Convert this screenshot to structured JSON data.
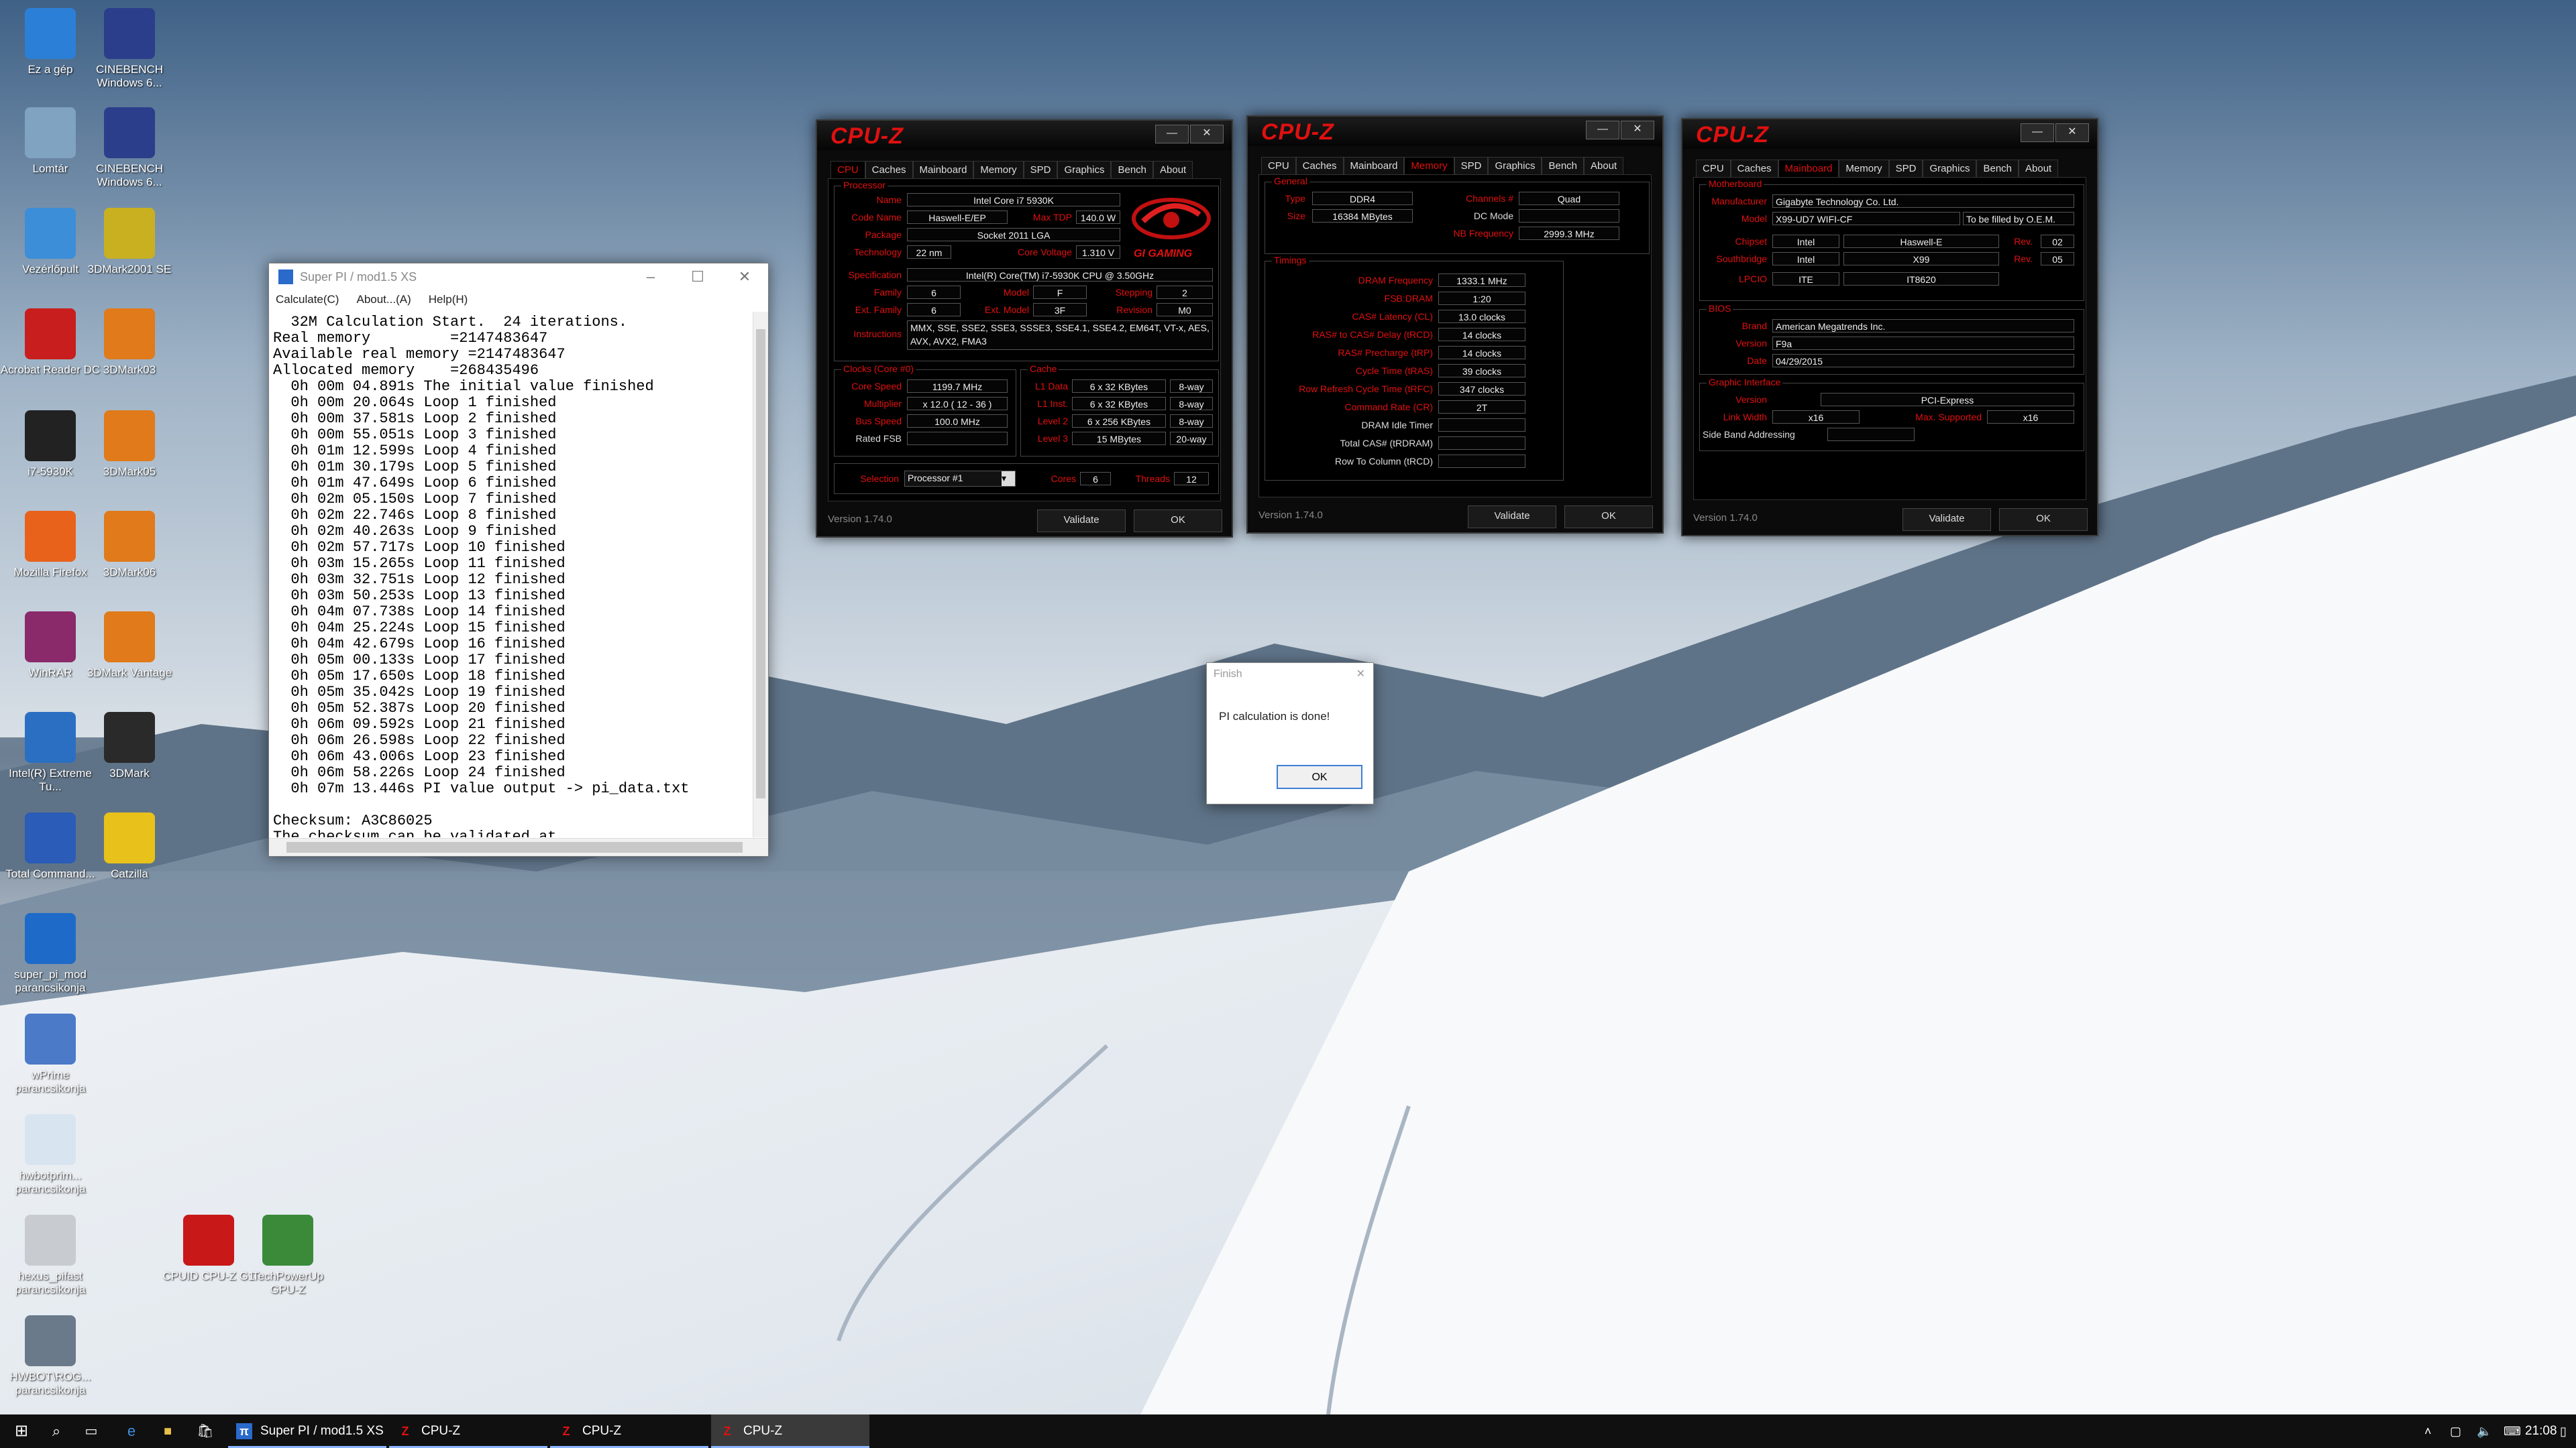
{
  "desktop_icons": [
    {
      "label": "Ez a gép",
      "icon": "computer-icon",
      "color": "#2c7fd6"
    },
    {
      "label": "CINEBENCH Windows 6...",
      "icon": "cinebench-icon",
      "color": "#2a3e8c"
    },
    {
      "label": "Lomtár",
      "icon": "recycle-bin-icon",
      "color": "#7fa3c0"
    },
    {
      "label": "CINEBENCH Windows 6...",
      "icon": "cinebench-icon",
      "color": "#2a3e8c"
    },
    {
      "label": "Vezérlőpult",
      "icon": "control-panel-icon",
      "color": "#3c8ed8"
    },
    {
      "label": "3DMark2001 SE",
      "icon": "3dmark2001-icon",
      "color": "#c9b020"
    },
    {
      "label": "Acrobat Reader DC",
      "icon": "acrobat-icon",
      "color": "#c81e1e"
    },
    {
      "label": "3DMark03",
      "icon": "3dmark03-icon",
      "color": "#e07a1a"
    },
    {
      "label": "i7-5930K",
      "icon": "file-icon",
      "color": "#222222"
    },
    {
      "label": "3DMark05",
      "icon": "3dmark05-icon",
      "color": "#e07a1a"
    },
    {
      "label": "Mozilla Firefox",
      "icon": "firefox-icon",
      "color": "#e8621c"
    },
    {
      "label": "3DMark06",
      "icon": "3dmark06-icon",
      "color": "#e07a1a"
    },
    {
      "label": "WinRAR",
      "icon": "winrar-icon",
      "color": "#8a2a6a"
    },
    {
      "label": "3DMark Vantage",
      "icon": "3dmark-vantage-icon",
      "color": "#e07a1a"
    },
    {
      "label": "Intel(R) Extreme Tu...",
      "icon": "intel-xtu-icon",
      "color": "#2b6fc2"
    },
    {
      "label": "3DMark",
      "icon": "3dmark-icon",
      "color": "#2a2a2a"
    },
    {
      "label": "Total Command...",
      "icon": "total-commander-icon",
      "color": "#2a5cb8"
    },
    {
      "label": "Catzilla",
      "icon": "catzilla-icon",
      "color": "#e8c21a"
    },
    {
      "label": "super_pi_mod parancsikonja",
      "icon": "super-pi-icon",
      "color": "#1e6ac8"
    },
    {
      "label": "wPrime parancsikonja",
      "icon": "wprime-icon",
      "color": "#4a7ac8"
    },
    {
      "label": "hwbotprim... parancsikonja",
      "icon": "java-icon",
      "color": "#d8e4f0"
    },
    {
      "label": "hexus_pifast parancsikonja",
      "icon": "pifast-icon",
      "color": "#c8ccd0"
    },
    {
      "label": "CPUID CPU-Z G1",
      "icon": "cpuz-g1-icon",
      "color": "#c81818"
    },
    {
      "label": "TechPowerUp GPU-Z",
      "icon": "gpuz-icon",
      "color": "#3a8a3a"
    },
    {
      "label": "HWBOT\\ROG... parancsikonja",
      "icon": "hwbot-icon",
      "color": "#6a7a8a"
    }
  ],
  "superpi": {
    "title": "Super PI / mod1.5 XS",
    "menu": [
      "Calculate(C)",
      "About...(A)",
      "Help(H)"
    ],
    "lines": [
      "  32M Calculation Start.  24 iterations.",
      "Real memory         =2147483647",
      "Available real memory =2147483647",
      "Allocated memory    =268435496",
      "  0h 00m 04.891s The initial value finished",
      "  0h 00m 20.064s Loop 1 finished",
      "  0h 00m 37.581s Loop 2 finished",
      "  0h 00m 55.051s Loop 3 finished",
      "  0h 01m 12.599s Loop 4 finished",
      "  0h 01m 30.179s Loop 5 finished",
      "  0h 01m 47.649s Loop 6 finished",
      "  0h 02m 05.150s Loop 7 finished",
      "  0h 02m 22.746s Loop 8 finished",
      "  0h 02m 40.263s Loop 9 finished",
      "  0h 02m 57.717s Loop 10 finished",
      "  0h 03m 15.265s Loop 11 finished",
      "  0h 03m 32.751s Loop 12 finished",
      "  0h 03m 50.253s Loop 13 finished",
      "  0h 04m 07.738s Loop 14 finished",
      "  0h 04m 25.224s Loop 15 finished",
      "  0h 04m 42.679s Loop 16 finished",
      "  0h 05m 00.133s Loop 17 finished",
      "  0h 05m 17.650s Loop 18 finished",
      "  0h 05m 35.042s Loop 19 finished",
      "  0h 05m 52.387s Loop 20 finished",
      "  0h 06m 09.592s Loop 21 finished",
      "  0h 06m 26.598s Loop 22 finished",
      "  0h 06m 43.006s Loop 23 finished",
      "  0h 06m 58.226s Loop 24 finished",
      "  0h 07m 13.446s PI value output -> pi_data.txt",
      "",
      "Checksum: A3C86025",
      "The checksum can be validated at"
    ]
  },
  "cpuz_common": {
    "logo": "CPU-Z",
    "tabs": [
      "CPU",
      "Caches",
      "Mainboard",
      "Memory",
      "SPD",
      "Graphics",
      "Bench",
      "About"
    ],
    "version": "Version 1.74.0",
    "validate": "Validate",
    "ok": "OK",
    "minimize": "—",
    "close": "✕"
  },
  "cpuz_cpu": {
    "group_processor": "Processor",
    "group_clocks": "Clocks (Core #0)",
    "group_cache": "Cache",
    "brand": "GI GAMING",
    "name_l": "Name",
    "name": "Intel Core i7 5930K",
    "codename_l": "Code Name",
    "codename": "Haswell-E/EP",
    "maxtdp_l": "Max TDP",
    "maxtdp": "140.0 W",
    "package_l": "Package",
    "package": "Socket 2011 LGA",
    "tech_l": "Technology",
    "tech": "22 nm",
    "voltage_l": "Core Voltage",
    "voltage": "1.310 V",
    "spec_l": "Specification",
    "spec": "Intel(R) Core(TM) i7-5930K CPU @ 3.50GHz",
    "family_l": "Family",
    "family": "6",
    "model_l": "Model",
    "model": "F",
    "stepping_l": "Stepping",
    "stepping": "2",
    "extfamily_l": "Ext. Family",
    "extfamily": "6",
    "extmodel_l": "Ext. Model",
    "extmodel": "3F",
    "revision_l": "Revision",
    "revision": "M0",
    "instr_l": "Instructions",
    "instr": "MMX, SSE, SSE2, SSE3, SSSE3, SSE4.1, SSE4.2, EM64T, VT-x, AES, AVX, AVX2, FMA3",
    "corespeed_l": "Core Speed",
    "corespeed": "1199.7 MHz",
    "mult_l": "Multiplier",
    "mult": "x 12.0 ( 12 - 36 )",
    "bus_l": "Bus Speed",
    "bus": "100.0 MHz",
    "fsb_l": "Rated FSB",
    "l1d_l": "L1 Data",
    "l1d": "6 x 32 KBytes",
    "l1d_w": "8-way",
    "l1i_l": "L1 Inst.",
    "l1i": "6 x 32 KBytes",
    "l1i_w": "8-way",
    "l2_l": "Level 2",
    "l2": "6 x 256 KBytes",
    "l2_w": "8-way",
    "l3_l": "Level 3",
    "l3": "15 MBytes",
    "l3_w": "20-way",
    "selection_l": "Selection",
    "selection": "Processor #1",
    "cores_l": "Cores",
    "cores": "6",
    "threads_l": "Threads",
    "threads": "12"
  },
  "cpuz_mem": {
    "group_general": "General",
    "group_timings": "Timings",
    "type_l": "Type",
    "type": "DDR4",
    "channels_l": "Channels #",
    "channels": "Quad",
    "size_l": "Size",
    "size": "16384 MBytes",
    "dcmode_l": "DC Mode",
    "nbfreq_l": "NB Frequency",
    "nbfreq": "2999.3 MHz",
    "timings": [
      {
        "label": "DRAM Frequency",
        "value": "1333.1 MHz",
        "red": true
      },
      {
        "label": "FSB:DRAM",
        "value": "1:20",
        "red": true
      },
      {
        "label": "CAS# Latency (CL)",
        "value": "13.0 clocks",
        "red": true
      },
      {
        "label": "RAS# to CAS# Delay (tRCD)",
        "value": "14 clocks",
        "red": true
      },
      {
        "label": "RAS# Precharge (tRP)",
        "value": "14 clocks",
        "red": true
      },
      {
        "label": "Cycle Time (tRAS)",
        "value": "39 clocks",
        "red": true
      },
      {
        "label": "Row Refresh Cycle Time (tRFC)",
        "value": "347 clocks",
        "red": true
      },
      {
        "label": "Command Rate (CR)",
        "value": "2T",
        "red": true
      },
      {
        "label": "DRAM Idle Timer",
        "value": "",
        "red": false
      },
      {
        "label": "Total CAS# (tRDRAM)",
        "value": "",
        "red": false
      },
      {
        "label": "Row To Column (tRCD)",
        "value": "",
        "red": false
      }
    ]
  },
  "cpuz_mb": {
    "group_motherboard": "Motherboard",
    "group_bios": "BIOS",
    "group_graphic": "Graphic Interface",
    "manufacturer_l": "Manufacturer",
    "manufacturer": "Gigabyte Technology Co. Ltd.",
    "model_l": "Model",
    "model": "X99-UD7 WIFI-CF",
    "model_oem": "To be filled by O.E.M.",
    "chipset_l": "Chipset",
    "chipset": "Intel",
    "chipset_name": "Haswell-E",
    "chipset_rev_l": "Rev.",
    "chipset_rev": "02",
    "south_l": "Southbridge",
    "south": "Intel",
    "south_name": "X99",
    "south_rev_l": "Rev.",
    "south_rev": "05",
    "lpcio_l": "LPCIO",
    "lpcio": "ITE",
    "lpcio_name": "IT8620",
    "brand_l": "Brand",
    "brand": "American Megatrends Inc.",
    "version_l": "Version",
    "version": "F9a",
    "date_l": "Date",
    "date": "04/29/2015",
    "gi_version_l": "Version",
    "gi_version": "PCI-Express",
    "linkwidth_l": "Link Width",
    "linkwidth": "x16",
    "maxsup_l": "Max. Supported",
    "maxsup": "x16",
    "sideband_l": "Side Band Addressing"
  },
  "finish": {
    "title": "Finish",
    "message": "PI calculation is done!",
    "ok": "OK"
  },
  "taskbar": {
    "apps": [
      {
        "label": "Super PI / mod1.5 XS",
        "icon": "superpi-task-icon"
      },
      {
        "label": "CPU-Z",
        "icon": "cpuz-task-icon"
      },
      {
        "label": "CPU-Z",
        "icon": "cpuz-task-icon"
      },
      {
        "label": "CPU-Z",
        "icon": "cpuz-task-icon"
      }
    ],
    "clock": "21:08"
  }
}
